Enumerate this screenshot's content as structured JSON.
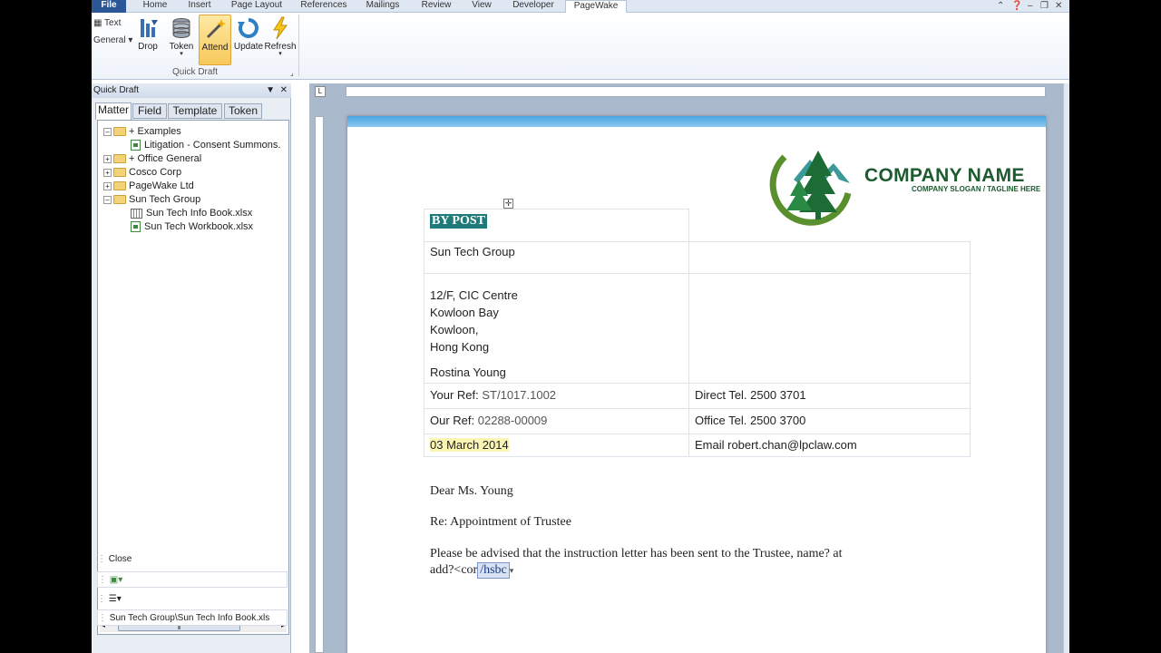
{
  "ribbon": {
    "tabs": [
      "File",
      "Home",
      "Insert",
      "Page Layout",
      "References",
      "Mailings",
      "Review",
      "View",
      "Developer",
      "PageWake"
    ],
    "active_tab": "PageWake",
    "small_left": {
      "text_label": "Text",
      "general_label": "General ▾"
    },
    "buttons": [
      {
        "label": "Drop",
        "icon": "drop-icon"
      },
      {
        "label": "Token",
        "icon": "database-icon"
      },
      {
        "label": "Attend",
        "icon": "wand-icon",
        "active": true
      },
      {
        "label": "Update",
        "icon": "refresh-cycle-icon"
      },
      {
        "label": "Refresh",
        "icon": "lightning-icon"
      }
    ],
    "group_name": "Quick Draft"
  },
  "pane": {
    "title": "Quick Draft",
    "tabs": [
      "Matter",
      "Field",
      "Template",
      "Token"
    ],
    "active_tab": "Matter",
    "tree": [
      {
        "label": "+ Examples",
        "type": "folder",
        "level": 0,
        "expanded": true
      },
      {
        "label": "Litigation - Consent Summons.",
        "type": "file",
        "level": 1
      },
      {
        "label": "+ Office General",
        "type": "folder",
        "level": 0
      },
      {
        "label": "Cosco Corp",
        "type": "folder",
        "level": 0
      },
      {
        "label": "PageWake Ltd",
        "type": "folder",
        "level": 0
      },
      {
        "label": "Sun Tech Group",
        "type": "folder",
        "level": 0,
        "expanded": true
      },
      {
        "label": "Sun Tech Info Book.xlsx",
        "type": "book",
        "level": 1
      },
      {
        "label": "Sun Tech Workbook.xlsx",
        "type": "file",
        "level": 1
      }
    ],
    "close_label": "Close",
    "path": "Sun Tech Group\\Sun Tech Info Book.xls"
  },
  "document": {
    "company_name": "COMPANY NAME",
    "company_slogan": "COMPANY SLOGAN / TAGLINE HERE",
    "by_post": "BY POST",
    "recipient": "Sun Tech Group",
    "address_lines": [
      "12/F, CIC Centre",
      "Kowloon Bay",
      "Kowloon,",
      "Hong Kong"
    ],
    "attention": "Rostina Young",
    "your_ref_label": "Your Ref:",
    "your_ref": "ST/1017.1002",
    "our_ref_label": "Our Ref:",
    "our_ref": "02288-00009",
    "date": "03 March 2014",
    "direct_tel": "Direct Tel. 2500 3701",
    "office_tel": "Office Tel. 2500 3700",
    "email": "Email robert.chan@lpclaw.com",
    "salutation": "Dear Ms. Young",
    "re_line": "Re: Appointment of Trustee",
    "body_line1": "Please be advised that the instruction letter has been sent to the Trustee, name? at",
    "body_line2_prefix": "add?<cor",
    "content_control": "/hsbc"
  },
  "colors": {
    "brand_green": "#1d5a2f",
    "ribbon_blue": "#2b5797",
    "highlight_teal": "#1f7a7a"
  }
}
